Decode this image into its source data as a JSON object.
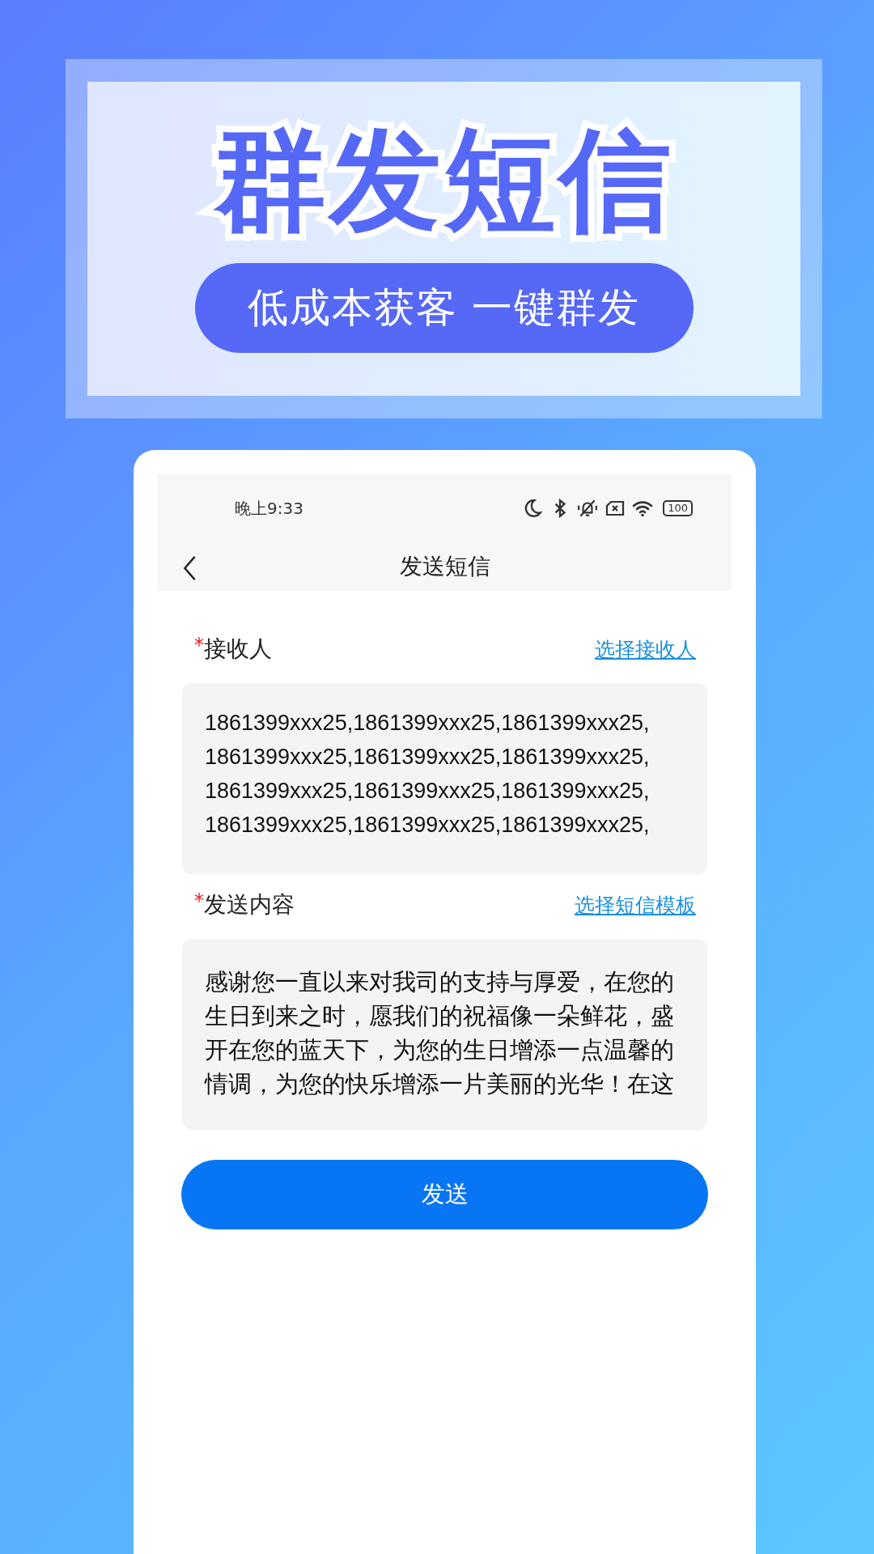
{
  "banner": {
    "title": "群发短信",
    "slogan": "低成本获客 一键群发"
  },
  "status_bar": {
    "time": "晚上9:33",
    "battery": "100"
  },
  "nav": {
    "title": "发送短信"
  },
  "fields": [
    {
      "kind": "recipients",
      "required_mark": "*",
      "label": "接收人",
      "action": "选择接收人",
      "entries": [
        "1861399xxx25,",
        "1861399xxx25,",
        "1861399xxx25,",
        "1861399xxx25,",
        "1861399xxx25,",
        "1861399xxx25,",
        "1861399xxx25,",
        "1861399xxx25,",
        "1861399xxx25,",
        "1861399xxx25,",
        "1861399xxx25,",
        "1861399xxx25,"
      ]
    },
    {
      "kind": "message",
      "required_mark": "*",
      "label": "发送内容",
      "action": "选择短信模板",
      "value": "感谢您一直以来对我司的支持与厚爱，在您的生日到来之时，愿我们的祝福像一朵鲜花，盛开在您的蓝天下，为您的生日增添一点温馨的情调，为您的快乐增添一片美丽的光华！在这"
    }
  ],
  "send_button": "发送"
}
